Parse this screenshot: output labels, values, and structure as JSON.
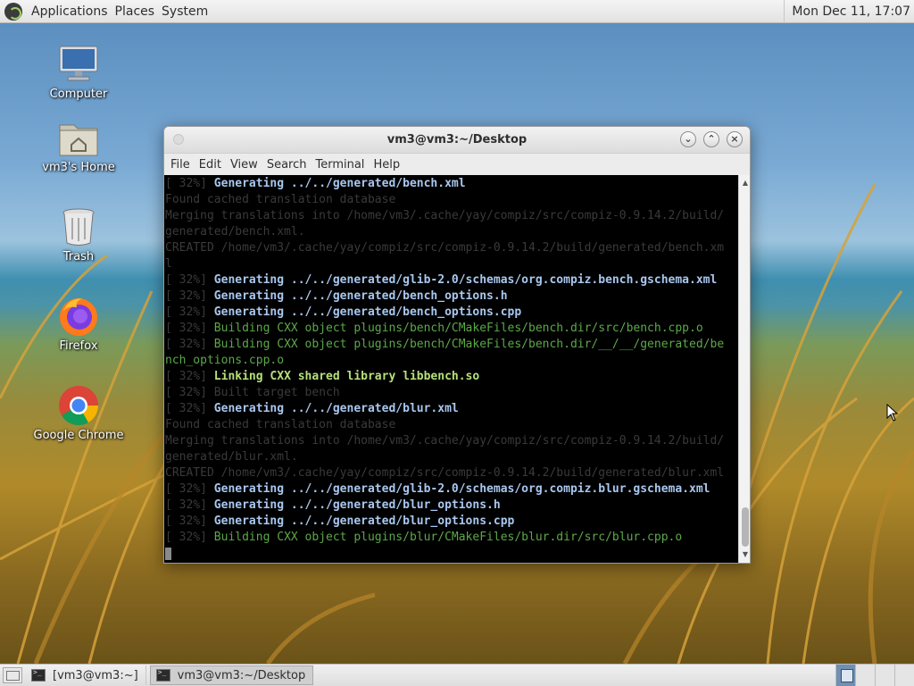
{
  "top_panel": {
    "menus": [
      "Applications",
      "Places",
      "System"
    ],
    "clock": "Mon Dec 11, 17:07"
  },
  "desktop_icons": [
    {
      "label": "Computer",
      "icon": "computer-icon"
    },
    {
      "label": "vm3's Home",
      "icon": "home-folder-icon"
    },
    {
      "label": "Trash",
      "icon": "trash-icon"
    },
    {
      "label": "Firefox",
      "icon": "firefox-icon"
    },
    {
      "label": "Google Chrome",
      "icon": "chrome-icon"
    }
  ],
  "terminal": {
    "title": "vm3@vm3:~/Desktop",
    "menus": [
      "File",
      "Edit",
      "View",
      "Search",
      "Terminal",
      "Help"
    ],
    "lines": [
      {
        "prefix": "[ 32%] ",
        "text": "Generating ../../generated/bench.xml",
        "style": "gen"
      },
      {
        "prefix": "",
        "text": "Found cached translation database",
        "style": "dim"
      },
      {
        "prefix": "",
        "text": "Merging translations into /home/vm3/.cache/yay/compiz/src/compiz-0.9.14.2/build/",
        "style": "dim"
      },
      {
        "prefix": "",
        "text": "generated/bench.xml.",
        "style": "dim"
      },
      {
        "prefix": "",
        "text": "CREATED /home/vm3/.cache/yay/compiz/src/compiz-0.9.14.2/build/generated/bench.xm",
        "style": "dim"
      },
      {
        "prefix": "",
        "text": "l",
        "style": "dim"
      },
      {
        "prefix": "[ 32%] ",
        "text": "Generating ../../generated/glib-2.0/schemas/org.compiz.bench.gschema.xml",
        "style": "gen"
      },
      {
        "prefix": "[ 32%] ",
        "text": "Generating ../../generated/bench_options.h",
        "style": "gen"
      },
      {
        "prefix": "[ 32%] ",
        "text": "Generating ../../generated/bench_options.cpp",
        "style": "gen"
      },
      {
        "prefix": "[ 32%] ",
        "text": "Building CXX object plugins/bench/CMakeFiles/bench.dir/src/bench.cpp.o",
        "style": "build"
      },
      {
        "prefix": "[ 32%] ",
        "text": "Building CXX object plugins/bench/CMakeFiles/bench.dir/__/__/generated/be",
        "style": "build"
      },
      {
        "prefix": "",
        "text": "nch_options.cpp.o",
        "style": "build"
      },
      {
        "prefix": "[ 32%] ",
        "text": "Linking CXX shared library libbench.so",
        "style": "link"
      },
      {
        "prefix": "[ 32%] ",
        "text": "Built target bench",
        "style": "dim"
      },
      {
        "prefix": "[ 32%] ",
        "text": "Generating ../../generated/blur.xml",
        "style": "gen"
      },
      {
        "prefix": "",
        "text": "Found cached translation database",
        "style": "dim"
      },
      {
        "prefix": "",
        "text": "Merging translations into /home/vm3/.cache/yay/compiz/src/compiz-0.9.14.2/build/",
        "style": "dim"
      },
      {
        "prefix": "",
        "text": "generated/blur.xml.",
        "style": "dim"
      },
      {
        "prefix": "",
        "text": "CREATED /home/vm3/.cache/yay/compiz/src/compiz-0.9.14.2/build/generated/blur.xml",
        "style": "dim"
      },
      {
        "prefix": "[ 32%] ",
        "text": "Generating ../../generated/glib-2.0/schemas/org.compiz.blur.gschema.xml",
        "style": "gen"
      },
      {
        "prefix": "[ 32%] ",
        "text": "Generating ../../generated/blur_options.h",
        "style": "gen"
      },
      {
        "prefix": "[ 32%] ",
        "text": "Generating ../../generated/blur_options.cpp",
        "style": "gen"
      },
      {
        "prefix": "[ 32%] ",
        "text": "Building CXX object plugins/blur/CMakeFiles/blur.dir/src/blur.cpp.o",
        "style": "build"
      }
    ]
  },
  "taskbar": {
    "tasks": [
      {
        "label": "[vm3@vm3:~]",
        "active": false
      },
      {
        "label": "vm3@vm3:~/Desktop",
        "active": true
      }
    ]
  }
}
